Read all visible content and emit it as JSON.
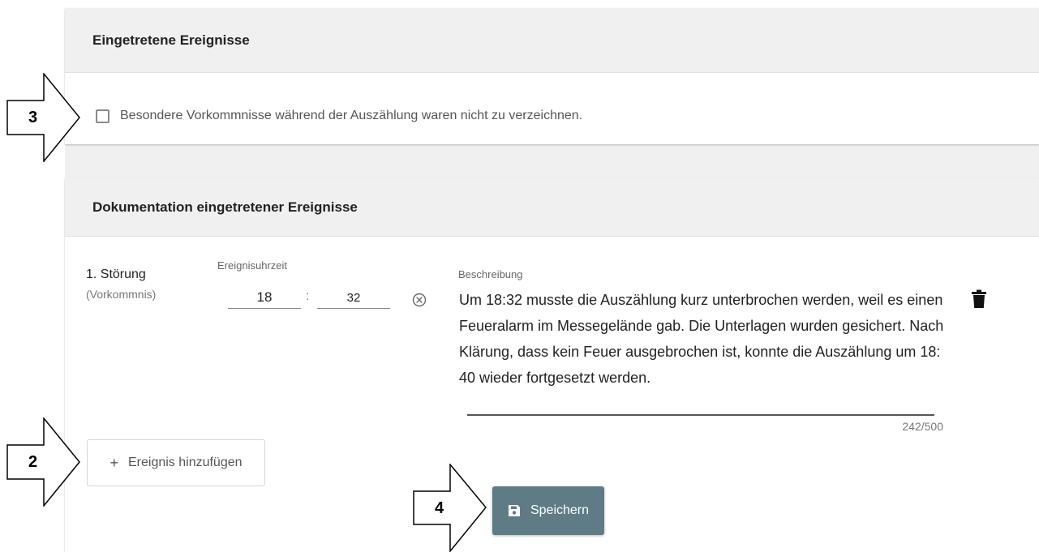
{
  "section_events": {
    "title": "Eingetretene Ereignisse",
    "checkbox_label": "Besondere Vorkommnisse während der Auszählung waren nicht zu verzeichnen.",
    "checkbox_checked": false
  },
  "section_documentation": {
    "title": "Dokumentation eingetretener Ereignisse",
    "event": {
      "type": "1. Störung",
      "kind": "(Vorkommnis)",
      "time_label": "Ereignisuhrzeit",
      "hour": "18",
      "minute": "32",
      "separator": ":",
      "description_label": "Beschreibung",
      "description": "Um 18:32  musste die Auszählung kurz unterbrochen werden, weil es einen Feueralarm im Messegelände gab. Die Unterlagen wurden gesichert. Nach Klärung, dass kein Feuer ausgebrochen ist, konnte die Auszählung um 18:40  wieder fortgesetzt werden.",
      "counter": "242/500"
    },
    "add_button_label": "Ereignis hinzufügen",
    "add_button_icon": "plus-icon",
    "save_button_label": "Speichern",
    "save_button_icon": "floppy-disk-icon"
  },
  "callouts": [
    "3",
    "2",
    "4"
  ],
  "colors": {
    "save_button": "#5f7c86",
    "header_bg": "#f0f0f0",
    "page_bg": "#ffffff"
  }
}
